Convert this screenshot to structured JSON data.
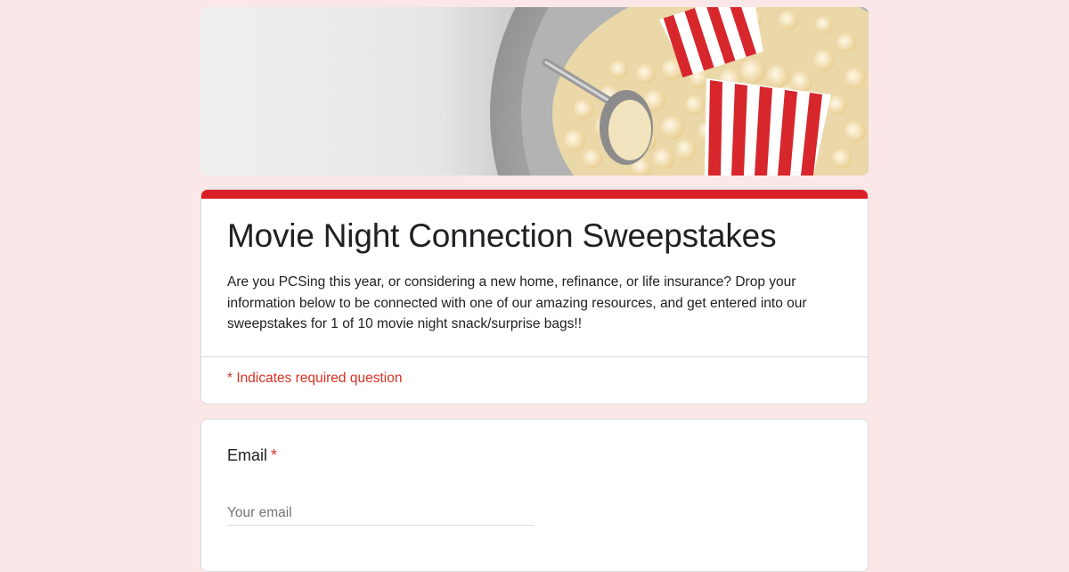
{
  "colors": {
    "page_background": "#fbe7e7",
    "accent": "#db1f26",
    "required": "#d93025"
  },
  "header": {
    "image": "popcorn-banner"
  },
  "form": {
    "title": "Movie Night Connection Sweepstakes",
    "description": "Are you PCSing this year, or considering a new home, refinance, or life insurance? Drop your information below to be connected with one of our amazing resources, and get entered into our sweepstakes for 1 of 10 movie night snack/surprise bags!!",
    "required_note": "* Indicates required question"
  },
  "questions": [
    {
      "label": "Email",
      "required_marker": "*",
      "placeholder": "Your email",
      "value": ""
    }
  ]
}
